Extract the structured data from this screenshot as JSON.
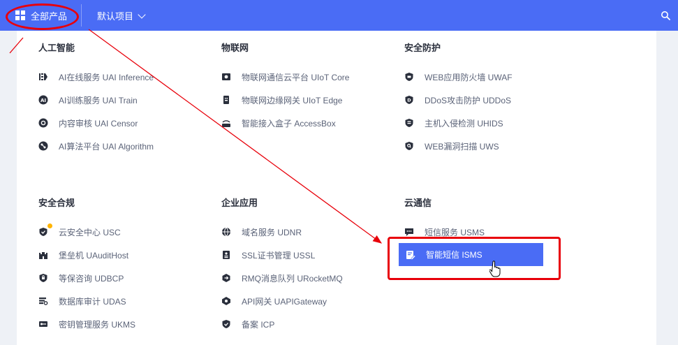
{
  "topbar": {
    "all_products": "全部产品",
    "default_project": "默认项目",
    "accent_color": "#4a6cf5"
  },
  "categories": [
    {
      "title": "人工智能",
      "items": [
        {
          "label": "AI在线服务 UAI Inference",
          "icon": "inference-icon"
        },
        {
          "label": "AI训练服务 UAI Train",
          "icon": "ai-train-icon"
        },
        {
          "label": "内容审核 UAI Censor",
          "icon": "censor-icon"
        },
        {
          "label": "AI算法平台 UAI Algorithm",
          "icon": "algorithm-icon"
        }
      ]
    },
    {
      "title": "物联网",
      "items": [
        {
          "label": "物联网通信云平台 UIoT Core",
          "icon": "iot-core-icon"
        },
        {
          "label": "物联网边缘网关 UIoT Edge",
          "icon": "iot-edge-icon"
        },
        {
          "label": "智能接入盒子 AccessBox",
          "icon": "access-box-icon"
        }
      ]
    },
    {
      "title": "安全防护",
      "items": [
        {
          "label": "WEB应用防火墙 UWAF",
          "icon": "shield-icon"
        },
        {
          "label": "DDoS攻击防护 UDDoS",
          "icon": "ddos-shield-icon"
        },
        {
          "label": "主机入侵检测 UHIDS",
          "icon": "host-shield-icon"
        },
        {
          "label": "WEB漏洞扫描 UWS",
          "icon": "scan-shield-icon"
        }
      ]
    },
    {
      "title": "安全合规",
      "items": [
        {
          "label": "云安全中心 USC",
          "icon": "security-center-icon"
        },
        {
          "label": "堡垒机 UAuditHost",
          "icon": "bastion-icon"
        },
        {
          "label": "等保咨询 UDBCP",
          "icon": "compliance-icon"
        },
        {
          "label": "数据库审计 UDAS",
          "icon": "database-audit-icon"
        },
        {
          "label": "密钥管理服务 UKMS",
          "icon": "key-icon"
        }
      ]
    },
    {
      "title": "企业应用",
      "items": [
        {
          "label": "域名服务 UDNR",
          "icon": "globe-icon"
        },
        {
          "label": "SSL证书管理 USSL",
          "icon": "certificate-icon"
        },
        {
          "label": "RMQ消息队列 URocketMQ",
          "icon": "queue-icon"
        },
        {
          "label": "API网关 UAPIGateway",
          "icon": "api-gateway-icon"
        },
        {
          "label": "备案 ICP",
          "icon": "icp-shield-icon"
        }
      ]
    },
    {
      "title": "云通信",
      "items": [
        {
          "label": "短信服务 USMS",
          "icon": "sms-icon"
        },
        {
          "label": "智能短信 ISMS",
          "icon": "smart-sms-icon",
          "active": true
        }
      ]
    }
  ],
  "annotation_color": "#e8000a"
}
